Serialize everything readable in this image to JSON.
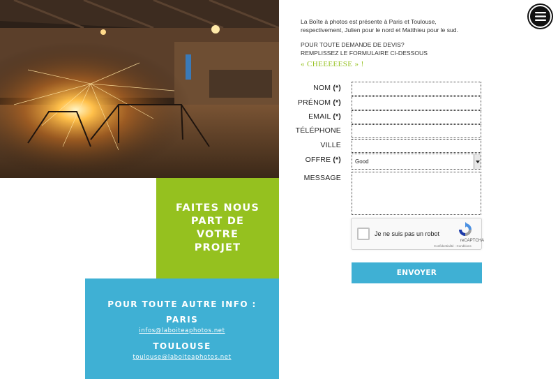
{
  "intro": {
    "line1": "La Boîte à photos est présente à Paris et Toulouse,",
    "line2": "respectivement, Julien pour le nord et Matthieu pour le sud.",
    "line3": "POUR TOUTE DEMANDE DE DEVIS?",
    "line4": "REMPLISSEZ LE FORMULAIRE CI-DESSOUS"
  },
  "cheese": "« CHEEEEESE » !",
  "menu": {
    "icon": "hamburger-menu-icon"
  },
  "form": {
    "required_mark": "(*)",
    "fields": [
      {
        "label": "NOM",
        "required": true
      },
      {
        "label": "PRÉNOM",
        "required": true
      },
      {
        "label": "EMAIL",
        "required": true
      },
      {
        "label": "TÉLÉPHONE",
        "required": false
      },
      {
        "label": "VILLE",
        "required": false
      }
    ],
    "offre": {
      "label": "OFFRE",
      "value": "Good"
    },
    "message": {
      "label": "MESSAGE"
    },
    "captcha": {
      "text": "Je ne suis pas un robot",
      "brand": "reCAPTCHA",
      "terms": "Confidentialité - Conditions"
    },
    "submit_label": "ENVOYER"
  },
  "green_block": {
    "title_line1": "FAITES NOUS",
    "title_line2": "PART DE",
    "title_line3": "VOTRE",
    "title_line4": "PROJET"
  },
  "blue_block": {
    "heading": "POUR TOUTE AUTRE INFO :",
    "city1": "PARIS",
    "email1": "infos@laboiteaphotos.net",
    "city2": "TOULOUSE",
    "email2": "toulouse@laboiteaphotos.net"
  },
  "colors": {
    "green": "#95c11f",
    "blue": "#3fb0d4"
  }
}
